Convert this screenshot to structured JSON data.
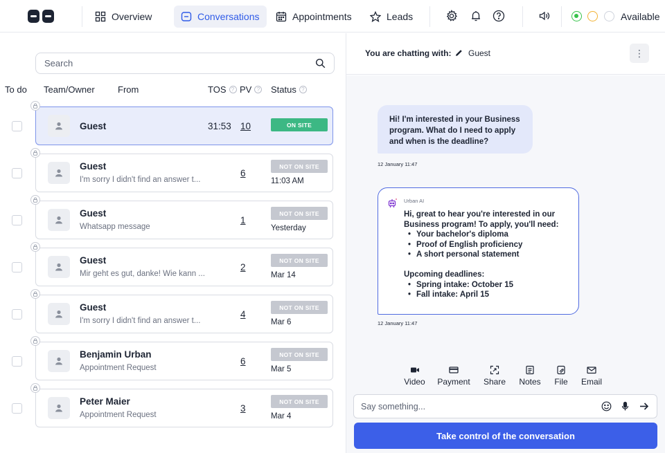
{
  "nav": {
    "items": [
      {
        "label": "Overview",
        "icon": "dashboard-icon"
      },
      {
        "label": "Conversations",
        "icon": "chat-bubble-icon",
        "active": true
      },
      {
        "label": "Appointments",
        "icon": "calendar-icon"
      },
      {
        "label": "Leads",
        "icon": "star-icon"
      }
    ],
    "availability": "Available",
    "accent": "#2f5be8"
  },
  "list": {
    "search_placeholder": "Search",
    "headers": {
      "todo": "To do",
      "team": "Team/Owner",
      "from": "From",
      "tos": "TOS",
      "pv": "PV",
      "status": "Status"
    },
    "rows": [
      {
        "name": "Guest",
        "preview": "",
        "tos": "31:53",
        "pv": "10",
        "status": "ON SITE",
        "time": ""
      },
      {
        "name": "Guest",
        "preview": "I'm sorry I didn't find an answer t...",
        "tos": "",
        "pv": "6",
        "status": "NOT ON SITE",
        "time": "11:03 AM"
      },
      {
        "name": "Guest",
        "preview": "Whatsapp message",
        "tos": "",
        "pv": "1",
        "status": "NOT ON SITE",
        "time": "Yesterday"
      },
      {
        "name": "Guest",
        "preview": "Mir geht es gut, danke! Wie kann ...",
        "tos": "",
        "pv": "2",
        "status": "NOT ON SITE",
        "time": "Mar 14"
      },
      {
        "name": "Guest",
        "preview": "I'm sorry I didn't find an answer t...",
        "tos": "",
        "pv": "4",
        "status": "NOT ON SITE",
        "time": "Mar 6"
      },
      {
        "name": "Benjamin Urban",
        "preview": "Appointment Request",
        "tos": "",
        "pv": "6",
        "status": "NOT ON SITE",
        "time": "Mar 5"
      },
      {
        "name": "Peter Maier",
        "preview": "Appointment Request",
        "tos": "",
        "pv": "3",
        "status": "NOT ON SITE",
        "time": "Mar 4"
      }
    ]
  },
  "chat": {
    "header_label": "You are chatting with:",
    "guest": "Guest",
    "user_message": "Hi! I'm interested in your Business program. What do I need to apply and when is the deadline?",
    "user_time": "12 January 11:47",
    "ai_sender": "Urban AI",
    "ai_intro": "Hi, great to hear you're interested in our Business program! To apply, you'll need:",
    "ai_requirements": [
      "Your bachelor's diploma",
      "Proof of English proficiency",
      "A short personal statement"
    ],
    "ai_deadlines_title": "Upcoming deadlines:",
    "ai_deadlines": [
      "Spring intake: October 15",
      "Fall intake: April 15"
    ],
    "ai_time": "12 January 11:47",
    "tools": [
      "Video",
      "Payment",
      "Share",
      "Notes",
      "File",
      "Email"
    ],
    "composer_placeholder": "Say something...",
    "take_control": "Take control of the conversation"
  }
}
